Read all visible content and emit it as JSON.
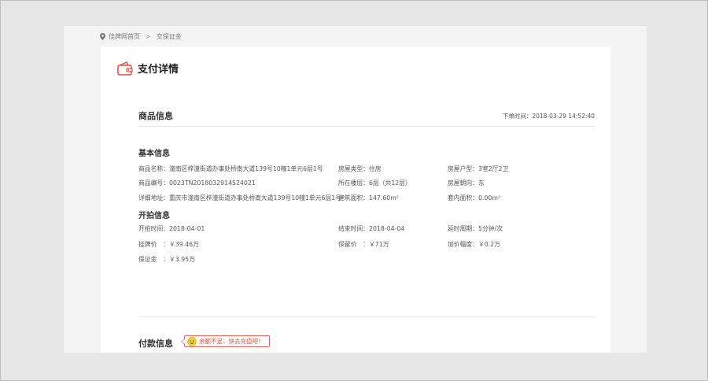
{
  "breadcrumb": {
    "home": "佳牌网首页",
    "separator": ">",
    "current": "交保证金"
  },
  "page_title": "支付详情",
  "goods_section": {
    "title": "商品信息",
    "order_time": "下单时间：2018-03-29 14:52:40"
  },
  "basic_info": {
    "title": "基本信息",
    "rows": [
      [
        "商品名称：潼南区梓潼街道办事处桥南大道139号10幢1单元6层1号",
        "房屋类型：住房",
        "房屋户型：3室2厅2卫"
      ],
      [
        "商品编号：0023TN2018032914524021",
        "所在楼层：6层（共12层）",
        "房屋朝向：东"
      ],
      [
        "详细地址：重庆市潼南区梓潼街道办事处桥南大道139号10幢1单元6层1号",
        "建筑面积：147.60m²",
        "套内面积：0.00m²"
      ]
    ]
  },
  "auction_info": {
    "title": "开拍信息",
    "rows": [
      [
        "开拍时间：2018-04-01",
        "结束时间：2018-04-04",
        "延时周期：5分钟/次"
      ],
      [
        "挂牌价　：￥39.46万",
        "保留价　：￥71万",
        "加价幅度：￥0.2万"
      ],
      [
        "保证金　：￥3.95万",
        "",
        ""
      ]
    ]
  },
  "payment_section": {
    "title": "付款信息",
    "notice": "余额不足，快去充值吧！"
  },
  "colors": {
    "accent": "#e24c3d",
    "background": "#e6e6e6",
    "card": "#ffffff"
  },
  "icons": {
    "breadcrumb": "location-pin-icon",
    "title": "wallet-icon",
    "notice": "smiley-icon"
  }
}
